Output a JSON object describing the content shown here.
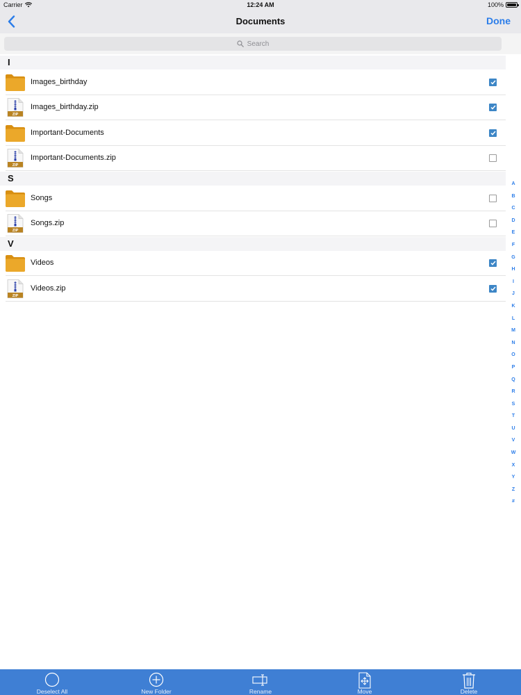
{
  "status_bar": {
    "carrier": "Carrier",
    "time": "12:24 AM",
    "battery": "100%"
  },
  "nav": {
    "title": "Documents",
    "done_label": "Done"
  },
  "search": {
    "placeholder": "Search"
  },
  "sections": [
    {
      "header": "I",
      "items": [
        {
          "name": "Images_birthday",
          "type": "folder",
          "checked": true
        },
        {
          "name": "Images_birthday.zip",
          "type": "zip",
          "checked": true
        },
        {
          "name": "Important-Documents",
          "type": "folder",
          "checked": true
        },
        {
          "name": "Important-Documents.zip",
          "type": "zip",
          "checked": false
        }
      ]
    },
    {
      "header": "S",
      "items": [
        {
          "name": "Songs",
          "type": "folder",
          "checked": false
        },
        {
          "name": "Songs.zip",
          "type": "zip",
          "checked": false
        }
      ]
    },
    {
      "header": "V",
      "items": [
        {
          "name": "Videos",
          "type": "folder",
          "checked": true
        },
        {
          "name": "Videos.zip",
          "type": "zip",
          "checked": true
        }
      ]
    }
  ],
  "zip_badge": "ZIP",
  "index_letters": [
    "A",
    "B",
    "C",
    "D",
    "E",
    "F",
    "G",
    "H",
    "I",
    "J",
    "K",
    "L",
    "M",
    "N",
    "O",
    "P",
    "Q",
    "R",
    "S",
    "T",
    "U",
    "V",
    "W",
    "X",
    "Y",
    "Z",
    "#"
  ],
  "toolbar": {
    "deselect_all": "Deselect All",
    "new_folder": "New Folder",
    "rename": "Rename",
    "move": "Move",
    "delete": "Delete"
  },
  "colors": {
    "accent": "#2b7de9",
    "toolbar_bg": "#3f7fd4",
    "folder": "#e8a31f",
    "checkbox": "#3d86c6"
  },
  "icons": {
    "folder": "folder-icon",
    "zip": "zip-file-icon",
    "back": "chevron-left-icon",
    "search": "search-icon",
    "deselect": "circle-icon",
    "new_folder": "plus-circle-icon",
    "rename": "rename-icon",
    "move": "move-icon",
    "delete": "trash-icon"
  }
}
